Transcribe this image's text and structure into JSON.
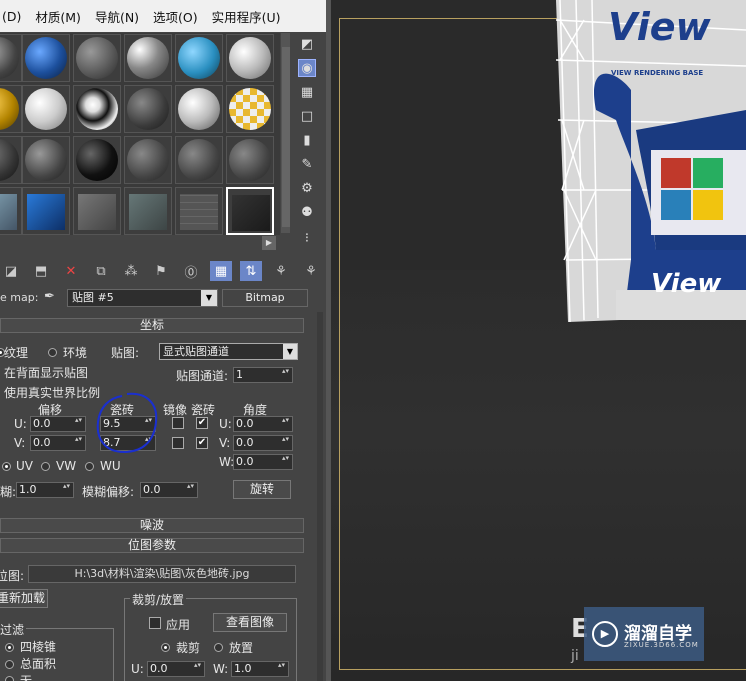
{
  "menu": [
    "(D)",
    "材质(M)",
    "导航(N)",
    "选项(O)",
    "实用程序(U)"
  ],
  "toolbar_right": {
    "bitmap": "Bitmap"
  },
  "map": {
    "label": "e map:",
    "name": "贴图 #5",
    "type": "Bitmap"
  },
  "coords": {
    "title": "坐标",
    "texture": "纹理",
    "environ": "环境",
    "mapping_label": "贴图:",
    "mapping_value": "显式贴图通道",
    "show_back": "在背面显示贴图",
    "map_channel_label": "贴图通道:",
    "map_channel_value": "1",
    "realworld": "使用真实世界比例",
    "offset": "偏移",
    "tiling": "瓷砖",
    "mirror": "镜像",
    "tile": "瓷砖",
    "angle": "角度",
    "u_label": "U:",
    "v_label": "V:",
    "w_label": "W:",
    "u_offset": "0.0",
    "v_offset": "0.0",
    "u_tiling": "9.5",
    "v_tiling": "8.7",
    "u_angle": "0.0",
    "v_angle": "0.0",
    "w_angle": "0.0",
    "uv": "UV",
    "vw": "VW",
    "wu": "WU",
    "blur_label": "糊:",
    "blur_value": "1.0",
    "blur_offset_label": "模糊偏移:",
    "blur_offset_value": "0.0",
    "rotate": "旋转"
  },
  "noise": {
    "title": "噪波"
  },
  "bitmap_params": {
    "title": "位图参数",
    "bitmap_label": "位图:",
    "path": "H:\\3d\\材料\\渲染\\贴图\\灰色地砖.jpg",
    "reload": "重新加载",
    "crop_title": "裁剪/放置",
    "apply": "应用",
    "view_image": "查看图像",
    "crop": "裁剪",
    "place": "放置",
    "u_label": "U:",
    "u_value": "0.0",
    "w_label": "W:",
    "w_value": "1.0",
    "filter_title": "过滤",
    "pyramidal": "四棱锥",
    "summed": "总面积",
    "none": "无"
  },
  "viewport": {
    "brand": "View",
    "brand_sub": "VIEW RENDERING BASE",
    "watermark_title": "溜溜自学",
    "watermark_sub": "ZIXUE.3D66.COM",
    "fragment1": "E",
    "fragment2": "ji"
  }
}
